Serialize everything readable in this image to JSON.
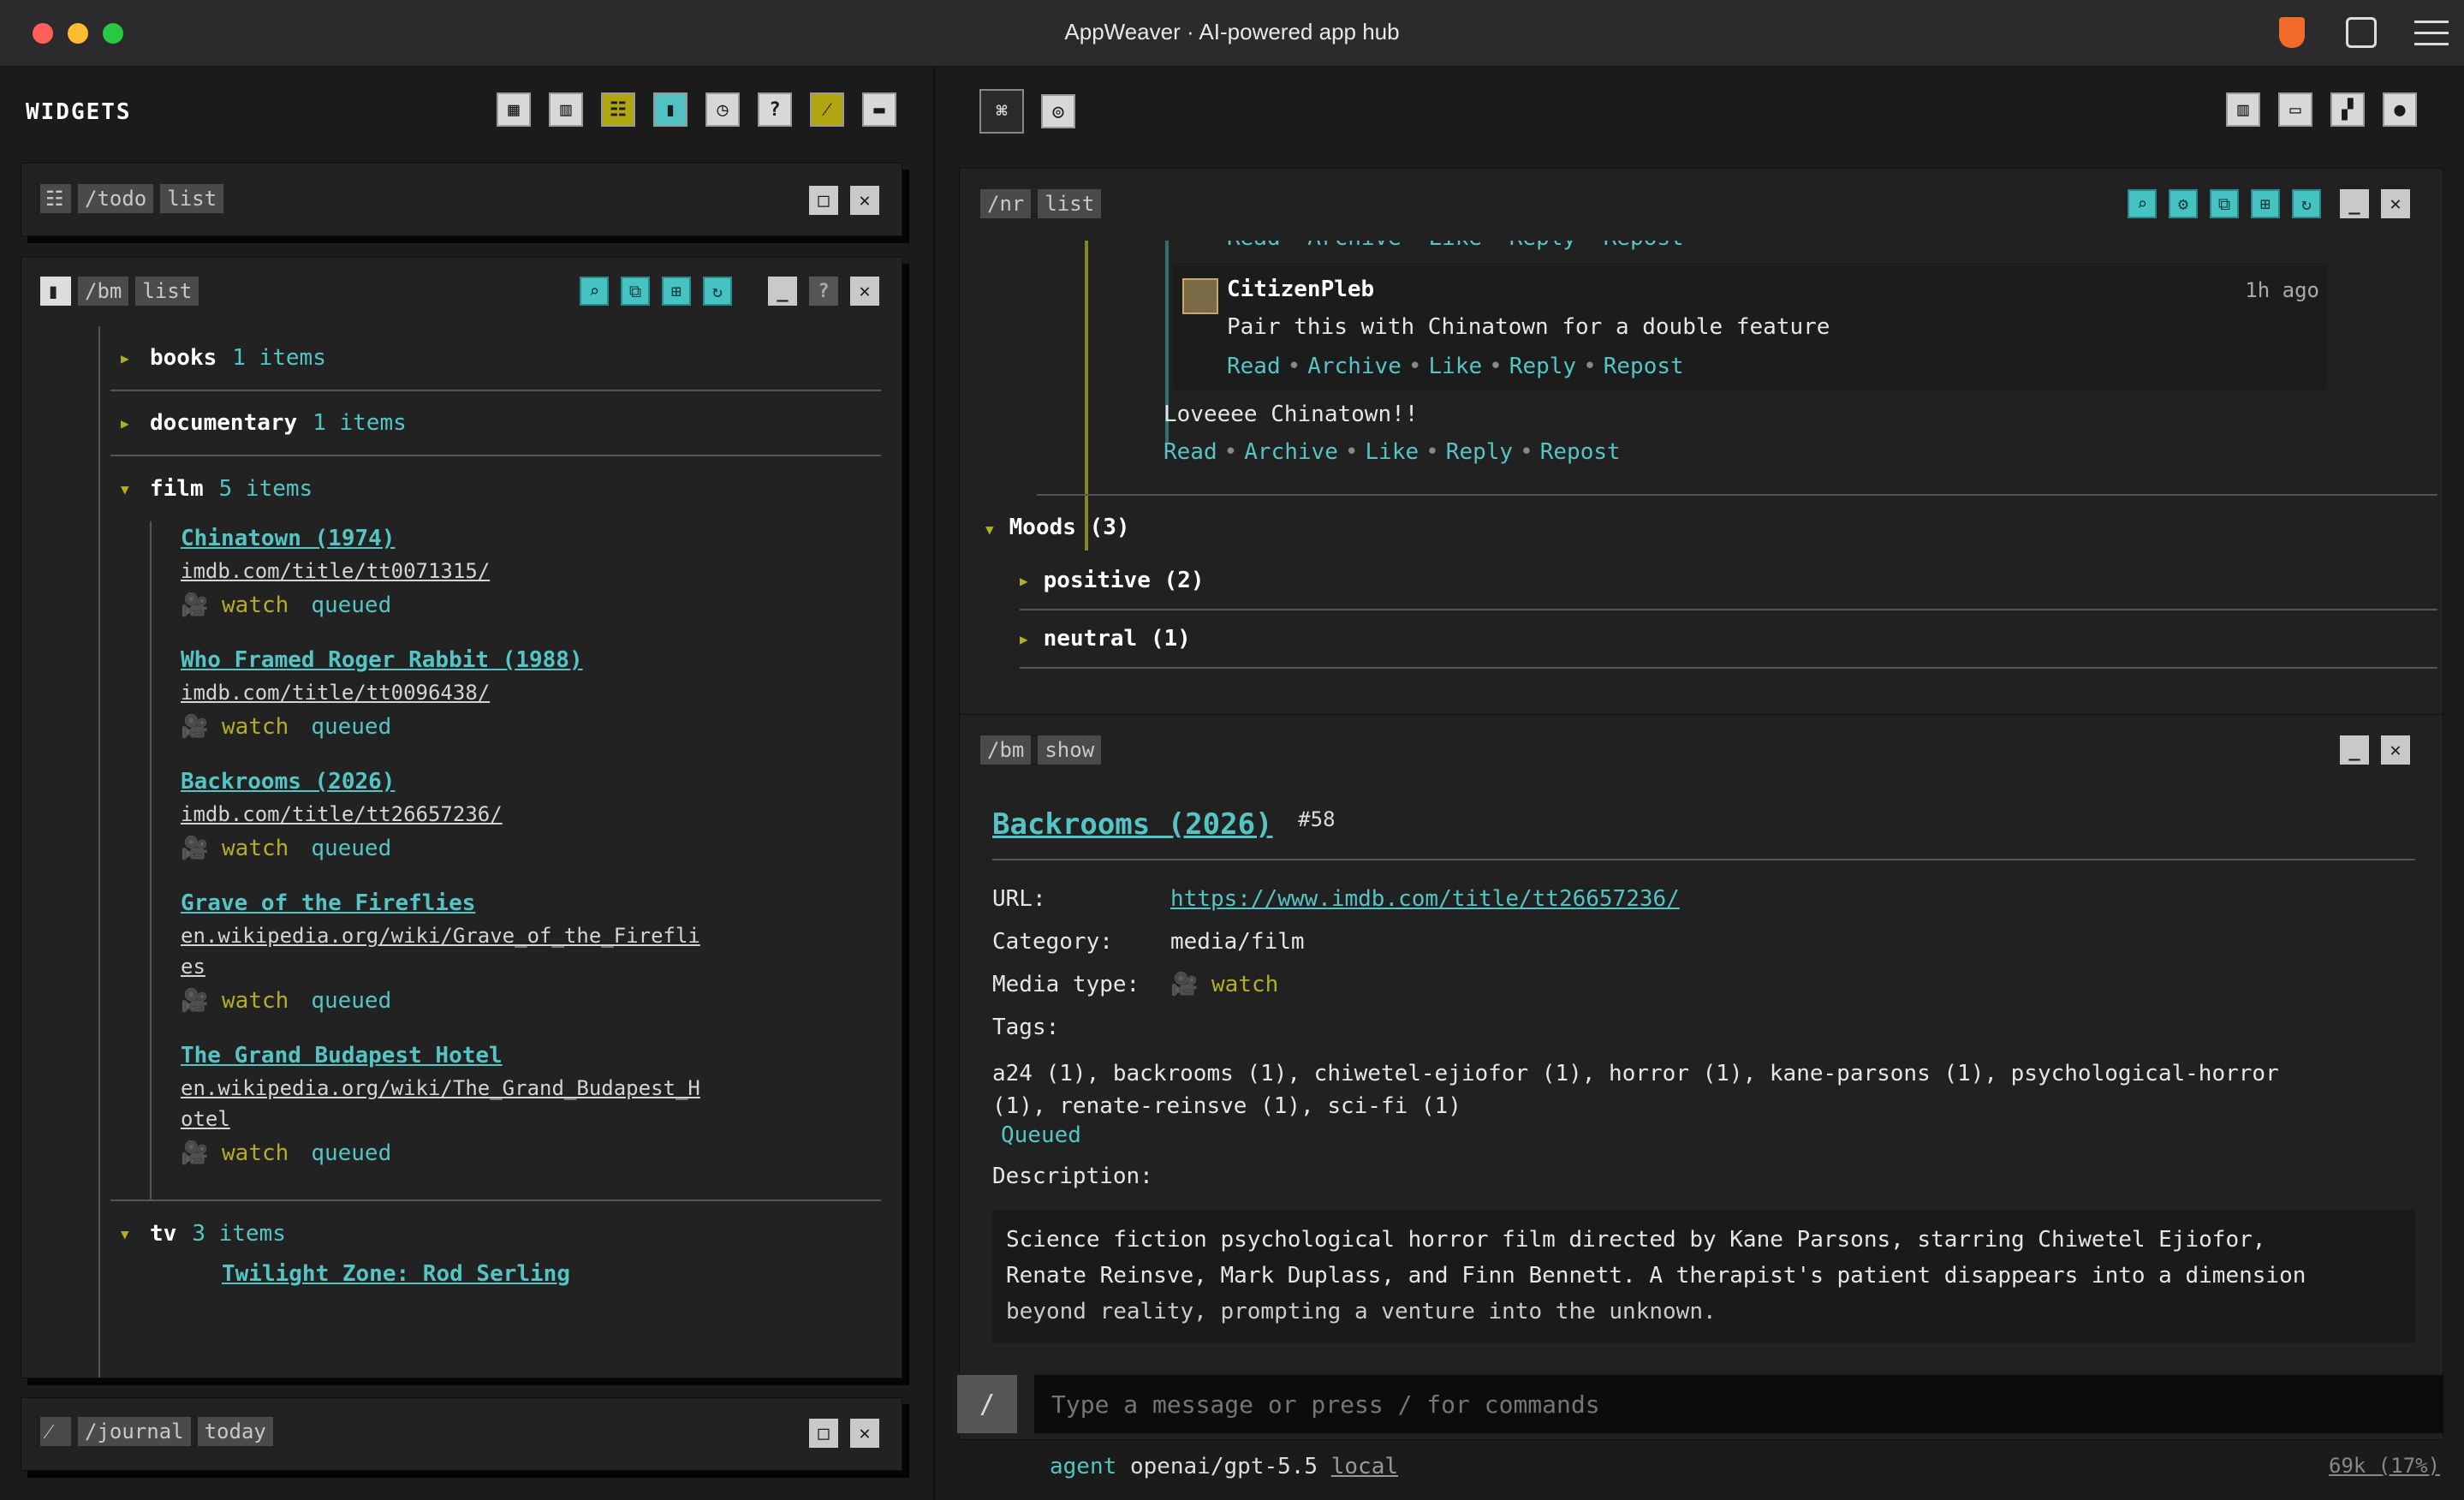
{
  "window": {
    "title": "AppWeaver · AI-powered app hub"
  },
  "colors": {
    "accent": "#54c4c4",
    "olive": "#b3ae2a",
    "bg": "#1b1b1b"
  },
  "sidebar": {
    "header": "WIDGETS"
  },
  "todo_widget": {
    "cmd": "/todo",
    "mode": "list"
  },
  "bm_widget": {
    "cmd": "/bm",
    "mode": "list",
    "categories": [
      {
        "name": "books",
        "count": "1 items"
      },
      {
        "name": "documentary",
        "count": "1 items"
      },
      {
        "name": "film",
        "count": "5 items"
      },
      {
        "name": "tv",
        "count": "3 items"
      }
    ],
    "films": [
      {
        "title": "Chinatown (1974)",
        "url": "imdb.com/title/tt0071315/",
        "media": "watch",
        "status": "queued"
      },
      {
        "title": "Who Framed Roger Rabbit (1988)",
        "url": "imdb.com/title/tt0096438/",
        "media": "watch",
        "status": "queued"
      },
      {
        "title": "Backrooms (2026)",
        "url": "imdb.com/title/tt26657236/",
        "media": "watch",
        "status": "queued"
      },
      {
        "title": "Grave of the Fireflies",
        "url": "en.wikipedia.org/wiki/Grave_of_the_Firefli",
        "url2": "es",
        "media": "watch",
        "status": "queued"
      },
      {
        "title": "The Grand Budapest Hotel",
        "url": "en.wikipedia.org/wiki/The_Grand_Budapest_H",
        "url2": "otel",
        "media": "watch",
        "status": "queued"
      }
    ],
    "tv_partial": "Twilight Zone: Rod Serling"
  },
  "journal_widget": {
    "cmd": "/journal",
    "mode": "today"
  },
  "nr_widget": {
    "cmd": "/nr",
    "mode": "list",
    "actions": [
      "Read",
      "Archive",
      "Like",
      "Reply",
      "Repost"
    ],
    "reply": {
      "user": "CitizenPleb",
      "time": "1h ago",
      "text": "Pair this with Chinatown for a double feature"
    },
    "post_text": "Loveeee Chinatown!!",
    "moods_label": "Moods (3)",
    "moods": [
      "positive (2)",
      "neutral (1)"
    ]
  },
  "show_widget": {
    "cmd": "/bm",
    "mode": "show",
    "title": "Backrooms (2026)",
    "id": "#58",
    "url_label": "URL:",
    "url": "https://www.imdb.com/title/tt26657236/",
    "category_label": "Category:",
    "category": "media/film",
    "media_label": "Media type:",
    "media": "watch",
    "tags_label": "Tags:",
    "tags_line1": "a24 (1), backrooms (1), chiwetel-ejiofor (1), horror (1), kane-parsons (1), psychological-horror",
    "tags_line2": "(1), renate-reinsve (1), sci-fi (1)",
    "status": "Queued",
    "desc_label": "Description:",
    "desc1": "Science fiction psychological horror film directed by Kane Parsons, starring Chiwetel Ejiofor,",
    "desc2": "Renate Reinsve, Mark Duplass, and Finn Bennett. A therapist's patient disappears into a dimension",
    "desc3": "beyond reality, prompting a venture into the unknown."
  },
  "input": {
    "slash": "/",
    "placeholder": "Type a message or press / for commands"
  },
  "status_bar": {
    "agent_label": "agent",
    "model": "openai/gpt-5.5",
    "mode": "local",
    "tokens": "69k (17%)"
  }
}
